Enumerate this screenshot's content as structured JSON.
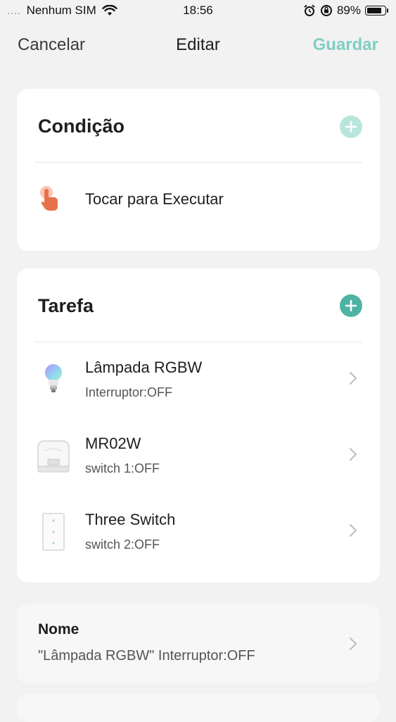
{
  "status": {
    "signal_dots": "....",
    "carrier": "Nenhum SIM",
    "time": "18:56",
    "battery_pct": "89%",
    "battery_level": 0.89
  },
  "nav": {
    "cancel": "Cancelar",
    "title": "Editar",
    "save": "Guardar"
  },
  "condition": {
    "title": "Condição",
    "trigger_label": "Tocar para Executar",
    "add_color": "#b9e5dd"
  },
  "task": {
    "title": "Tarefa",
    "add_color": "#4fb3a4",
    "items": [
      {
        "name": "Lâmpada RGBW",
        "action": "Interruptor:OFF",
        "icon": "bulb-icon"
      },
      {
        "name": "MR02W",
        "action": "switch 1:OFF",
        "icon": "controller-icon"
      },
      {
        "name": "Three Switch",
        "action": "switch 2:OFF",
        "icon": "wall-switch-icon"
      }
    ]
  },
  "name_section": {
    "label": "Nome",
    "value": "\"Lâmpada RGBW\" Interruptor:OFF"
  },
  "colors": {
    "accent": "#7fcfc0",
    "hand": "#e8724a"
  }
}
